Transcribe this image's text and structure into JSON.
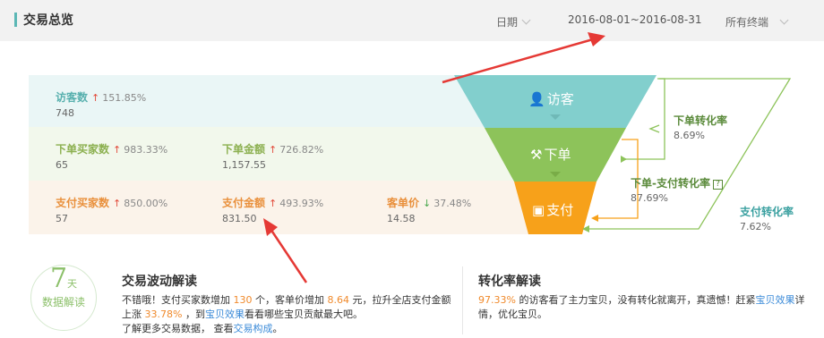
{
  "header": {
    "title": "交易总览",
    "date_label": "日期",
    "date_range": "2016-08-01~2016-08-31",
    "terminal": "所有终端"
  },
  "metrics": {
    "visitors": {
      "label": "访客数",
      "arrow": "↑",
      "pct": "151.85%",
      "value": "748"
    },
    "order_buyers": {
      "label": "下单买家数",
      "arrow": "↑",
      "pct": "983.33%",
      "value": "65"
    },
    "order_amount": {
      "label": "下单金额",
      "arrow": "↑",
      "pct": "726.82%",
      "value": "1,157.55"
    },
    "pay_buyers": {
      "label": "支付买家数",
      "arrow": "↑",
      "pct": "850.00%",
      "value": "57"
    },
    "pay_amount": {
      "label": "支付金额",
      "arrow": "↑",
      "pct": "493.93%",
      "value": "831.50"
    },
    "unit_price": {
      "label": "客单价",
      "arrow": "↓",
      "pct": "37.48%",
      "value": "14.58"
    }
  },
  "funnel": {
    "visit_label": "访客",
    "order_label": "下单",
    "pay_label": "支付",
    "colors": {
      "visit": "#82cfcd",
      "order": "#8dc35a",
      "pay": "#f7a11a"
    }
  },
  "conversions": {
    "order_rate": {
      "name": "下单转化率",
      "value": "8.69%"
    },
    "order_pay_rate": {
      "name": "下单-支付转化率",
      "help": "?",
      "value": "87.69%"
    },
    "pay_rate": {
      "name": "支付转化率",
      "value": "7.62%"
    }
  },
  "badge": {
    "number": "7",
    "unit": "天",
    "caption": "数据解读"
  },
  "fluctuation": {
    "title": "交易波动解读",
    "p1_a": "不错哦！支付买家数增加 ",
    "p1_b": "130",
    "p1_c": " 个，客单价增加 ",
    "p1_d": "8.64",
    "p1_e": " 元，拉升全店支付金额",
    "p2_a": "上涨 ",
    "p2_b": "33.78%",
    "p2_c": " ，到",
    "p2_link": "宝贝效果",
    "p2_d": "看看哪些宝贝贡献最大吧。",
    "p3_a": "了解更多交易数据，  查看",
    "p3_link": "交易构成",
    "p3_b": "。"
  },
  "conversion_read": {
    "title": "转化率解读",
    "p1_a": "97.33%",
    "p1_b": " 的访客看了主力宝贝，没有转化就离开，真遗憾！赶紧",
    "p1_link": "宝贝效果",
    "p1_c": "详",
    "p2": "情，优化宝贝。"
  }
}
